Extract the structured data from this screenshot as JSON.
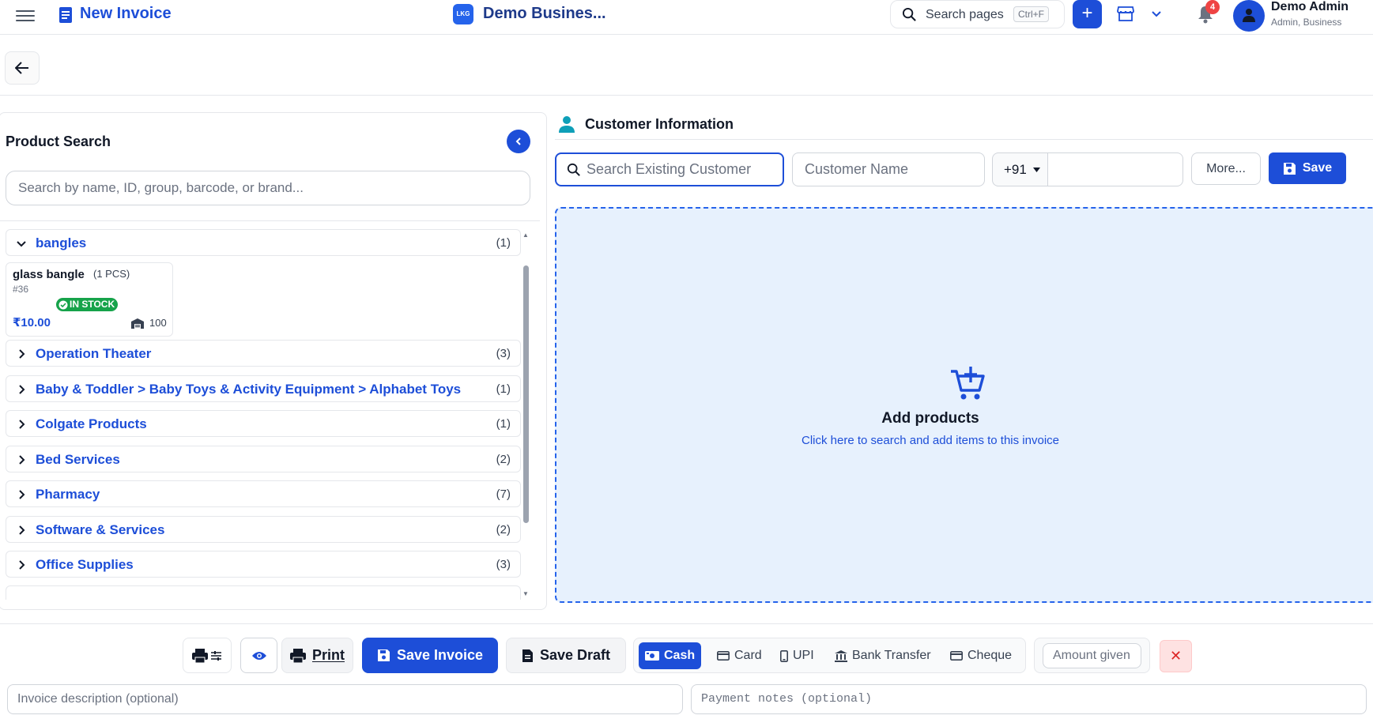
{
  "header": {
    "page_title": "New Invoice",
    "business_logo_text": "LKG",
    "business_name": "Demo Busines...",
    "search_label": "Search pages",
    "search_shortcut": "Ctrl+F",
    "plus_label": "+",
    "notification_count": "4",
    "user_name": "Demo Admin",
    "user_role": "Admin, Business",
    "brand_color": "#1d4ed8"
  },
  "product_search": {
    "title": "Product Search",
    "placeholder": "Search by name, ID, group, barcode, or brand...",
    "categories": [
      {
        "name": "bangles",
        "count": "(1)",
        "expanded": true
      },
      {
        "name": "Operation Theater",
        "count": "(3)"
      },
      {
        "name": "Baby & Toddler > Baby Toys & Activity Equipment > Alphabet Toys",
        "count": "(1)"
      },
      {
        "name": "Colgate Products",
        "count": "(1)"
      },
      {
        "name": "Bed Services",
        "count": "(2)"
      },
      {
        "name": "Pharmacy",
        "count": "(7)"
      },
      {
        "name": "Software & Services",
        "count": "(2)"
      },
      {
        "name": "Office Supplies",
        "count": "(3)"
      }
    ],
    "product": {
      "name": "glass bangle",
      "unit": "(1 PCS)",
      "id": "#36",
      "stock_label": "IN STOCK",
      "price": "₹10.00",
      "quantity": "100"
    }
  },
  "customer": {
    "title": "Customer Information",
    "search_placeholder": "Search Existing Customer",
    "name_placeholder": "Customer Name",
    "country_code": "+91",
    "more_label": "More...",
    "save_label": "Save"
  },
  "add_products": {
    "title": "Add products",
    "subtitle": "Click here to search and add items to this invoice"
  },
  "bottom": {
    "print_label": "Print",
    "save_invoice_label": "Save Invoice",
    "save_draft_label": "Save Draft",
    "payment_methods": [
      {
        "label": "Cash",
        "active": true
      },
      {
        "label": "Card"
      },
      {
        "label": "UPI"
      },
      {
        "label": "Bank Transfer"
      },
      {
        "label": "Cheque"
      }
    ],
    "amount_placeholder": "Amount given",
    "clear_label": "✕",
    "description_placeholder": "Invoice description (optional)",
    "notes_placeholder": "Payment notes (optional)"
  }
}
